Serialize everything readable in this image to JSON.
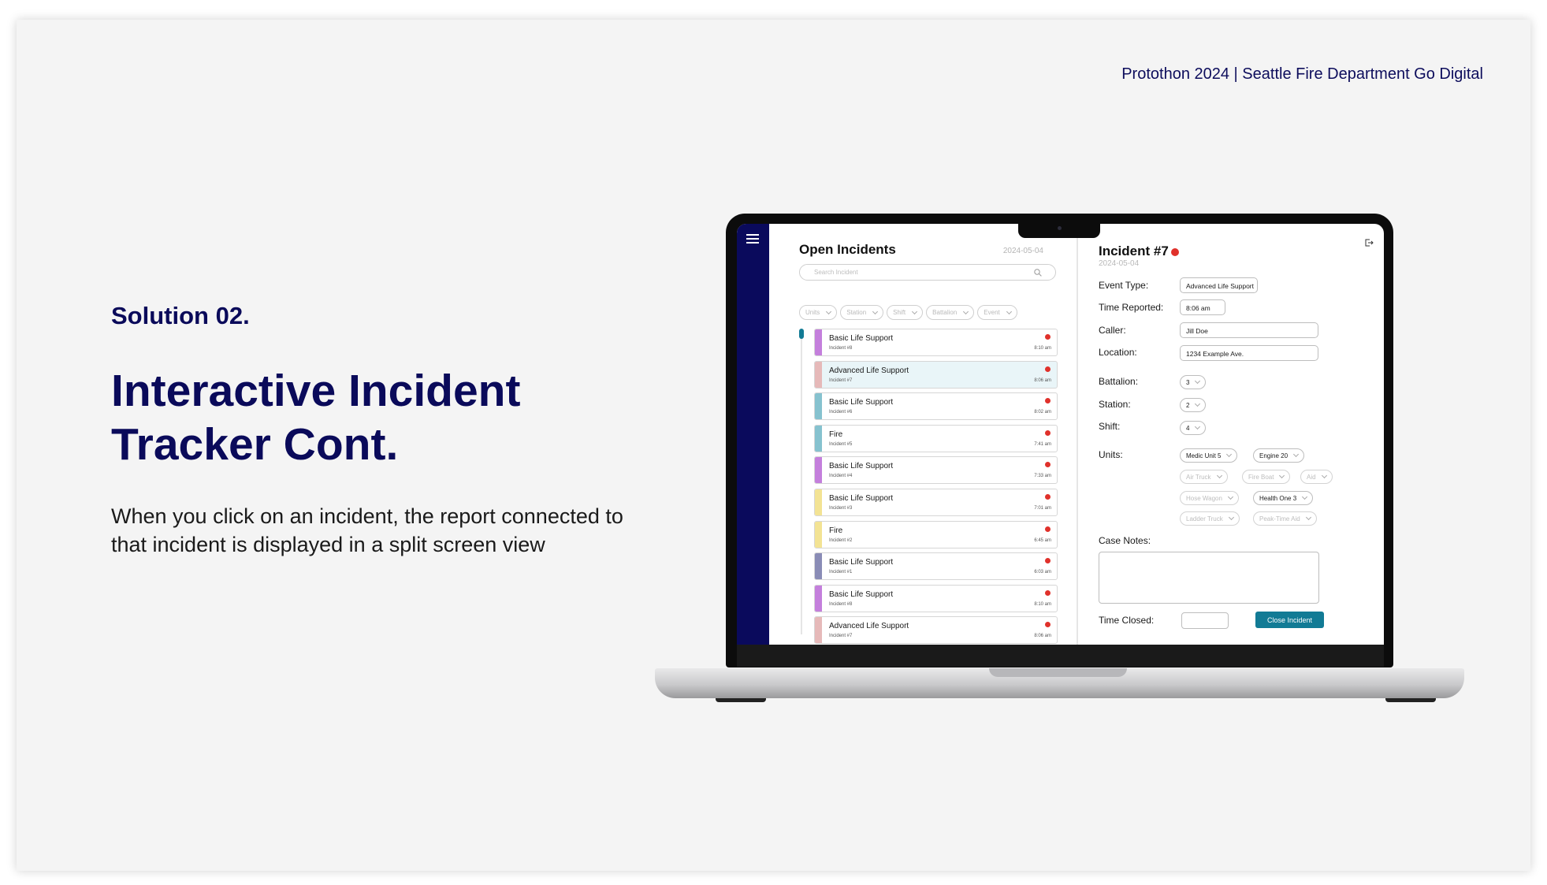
{
  "slide": {
    "header": "Protothon 2024 | Seattle Fire Department Go Digital",
    "solution_label": "Solution 02.",
    "title": "Interactive Incident Tracker Cont.",
    "description": "When you click on an incident, the report connected to that incident is displayed in a split screen view"
  },
  "app": {
    "list": {
      "title": "Open Incidents",
      "date": "2024-05-04",
      "search_placeholder": "Search Incident",
      "filters": [
        "Units",
        "Station",
        "Shift",
        "Battalion",
        "Event"
      ],
      "incidents": [
        {
          "type": "Basic Life Support",
          "number": "Incident #8",
          "time": "8:10 am",
          "color": "#c47fdc",
          "active": false
        },
        {
          "type": "Advanced Life Support",
          "number": "Incident #7",
          "time": "8:06 am",
          "color": "#e6b9b9",
          "active": true
        },
        {
          "type": "Basic Life Support",
          "number": "Incident #6",
          "time": "8:02 am",
          "color": "#86c2cf",
          "active": false
        },
        {
          "type": "Fire",
          "number": "Incident #5",
          "time": "7:41 am",
          "color": "#86c2cf",
          "active": false
        },
        {
          "type": "Basic Life Support",
          "number": "Incident #4",
          "time": "7:33 am",
          "color": "#c47fdc",
          "active": false
        },
        {
          "type": "Basic Life Support",
          "number": "Incident #3",
          "time": "7:01 am",
          "color": "#f3e394",
          "active": false
        },
        {
          "type": "Fire",
          "number": "Incident #2",
          "time": "6:45 am",
          "color": "#f3e394",
          "active": false
        },
        {
          "type": "Basic Life Support",
          "number": "Incident #1",
          "time": "6:03 am",
          "color": "#8a8cb6",
          "active": false
        },
        {
          "type": "Basic Life Support",
          "number": "Incident #8",
          "time": "8:10 am",
          "color": "#c47fdc",
          "active": false
        },
        {
          "type": "Advanced Life Support",
          "number": "Incident #7",
          "time": "8:06 am",
          "color": "#e6b9b9",
          "active": false
        }
      ]
    },
    "detail": {
      "title": "Incident #7",
      "date": "2024-05-04",
      "event_type_label": "Event Type:",
      "event_type": "Advanced Life Support",
      "time_reported_label": "Time Reported:",
      "time_reported": "8:06 am",
      "caller_label": "Caller:",
      "caller": "Jill Doe",
      "location_label": "Location:",
      "location": "1234 Example Ave.",
      "battalion_label": "Battalion:",
      "battalion": "3",
      "station_label": "Station:",
      "station": "2",
      "shift_label": "Shift:",
      "shift": "4",
      "units_label": "Units:",
      "units": {
        "medic": "Medic Unit 5",
        "engine": "Engine 20",
        "air_truck": "Air Truck",
        "fire_boat": "Fire Boat",
        "aid": "Aid",
        "hose_wagon": "Hose Wagon",
        "health_one": "Health One 3",
        "ladder_truck": "Ladder Truck",
        "peak_time_aid": "Peak-Time Aid"
      },
      "case_notes_label": "Case Notes:",
      "time_closed_label": "Time Closed:",
      "close_button": "Close Incident"
    }
  },
  "colors": {
    "navy": "#0a0a5c",
    "accent": "#127b95",
    "alert_dot": "#e0312b"
  }
}
